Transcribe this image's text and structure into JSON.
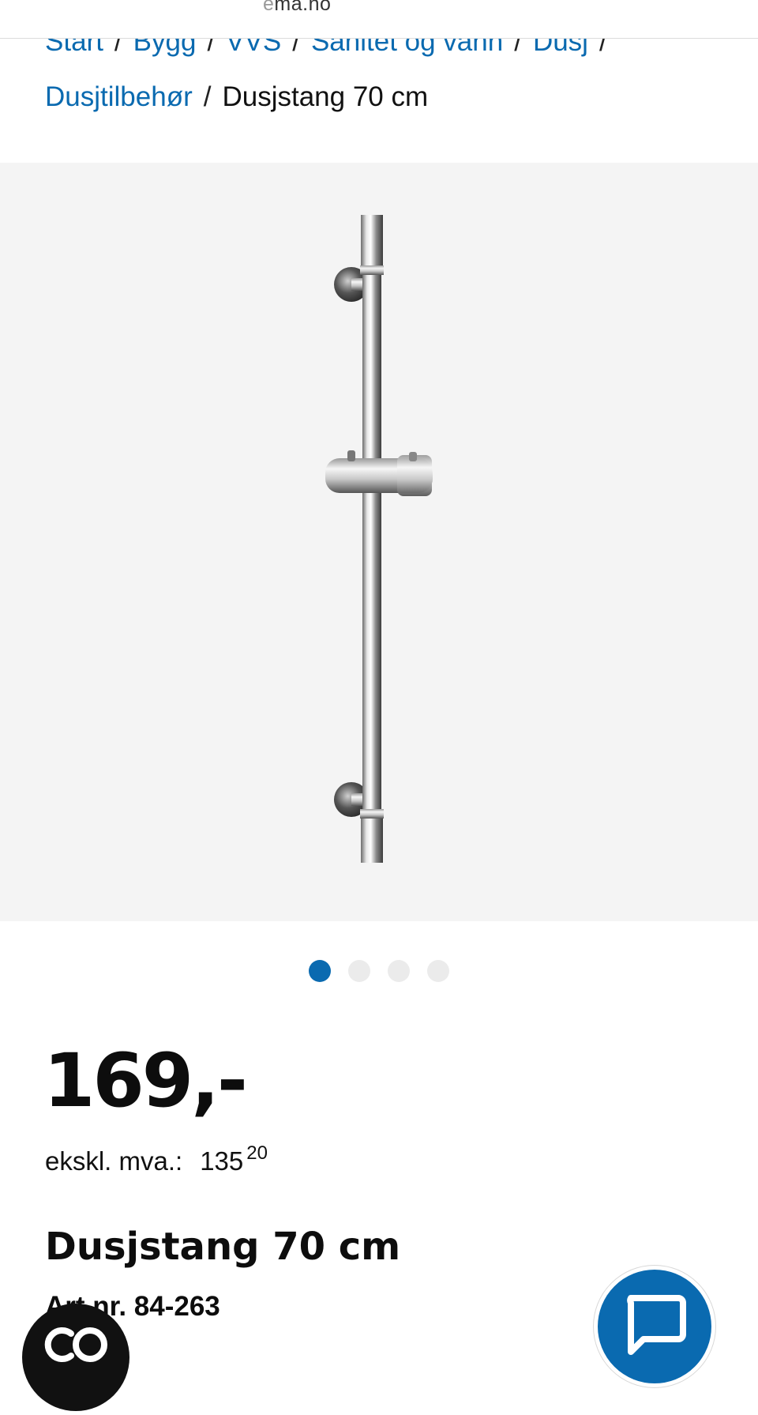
{
  "browser": {
    "url_prefix_faded": "e",
    "url_main": "ma.no"
  },
  "breadcrumb": {
    "items": [
      "Start",
      "Bygg",
      "VVS",
      "Sanitet og vann",
      "Dusj",
      "Dusjtilbehør"
    ],
    "separator": "/",
    "current": "Dusjstang 70 cm"
  },
  "gallery": {
    "image_subject": "shower rail",
    "image_count": 4,
    "active_index": 0
  },
  "product": {
    "price": "169,-",
    "price_ex_label": "ekskl. mva.:",
    "price_ex_whole": "135",
    "price_ex_decimals": "20",
    "title": "Dusjstang 70 cm",
    "art_nr": "Art.nr. 84-263"
  },
  "floating": {
    "co_label": "CO",
    "chat_icon": "chat-bubble-icon"
  },
  "colors": {
    "accent": "#0a6ab0",
    "gallery_bg": "#f4f4f4",
    "text": "#111111"
  }
}
